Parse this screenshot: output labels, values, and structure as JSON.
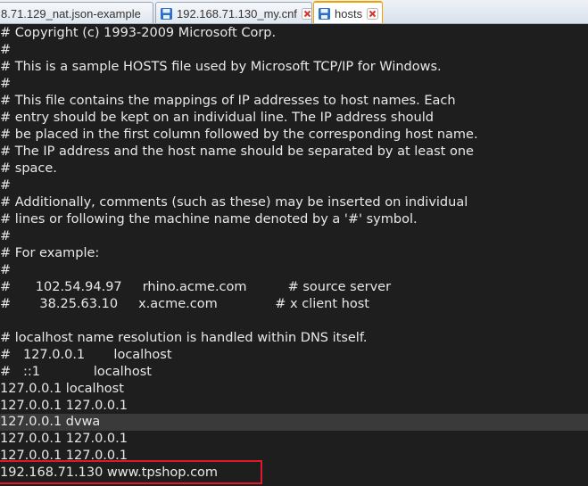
{
  "tabs": [
    {
      "label": "8.71.129_nat.json-example",
      "icon": "saved-file-icon",
      "active": false
    },
    {
      "label": "192.168.71.130_my.cnf",
      "icon": "saved-file-icon",
      "active": false
    },
    {
      "label": "hosts",
      "icon": "saved-file-icon",
      "active": true
    }
  ],
  "colors": {
    "editor_bg": "#1e1e1e",
    "text": "#e8e8e8",
    "highlight_row": "#3a3a3a",
    "active_tab_accent": "#f0a000",
    "annotation_box": "#e0182a",
    "close_icon": "#d9342b"
  },
  "editor": {
    "lines": [
      "# Copyright (c) 1993-2009 Microsoft Corp.",
      "#",
      "# This is a sample HOSTS file used by Microsoft TCP/IP for Windows.",
      "#",
      "# This file contains the mappings of IP addresses to host names. Each",
      "# entry should be kept on an individual line. The IP address should",
      "# be placed in the first column followed by the corresponding host name.",
      "# The IP address and the host name should be separated by at least one",
      "# space.",
      "#",
      "# Additionally, comments (such as these) may be inserted on individual",
      "# lines or following the machine name denoted by a '#' symbol.",
      "#",
      "# For example:",
      "#",
      "#      102.54.94.97     rhino.acme.com          # source server",
      "#       38.25.63.10     x.acme.com              # x client host",
      "",
      "# localhost name resolution is handled within DNS itself.",
      "#   127.0.0.1       localhost",
      "#   ::1             localhost",
      "127.0.0.1 localhost",
      "127.0.0.1 127.0.0.1",
      "127.0.0.1 dvwa",
      "127.0.0.1 127.0.0.1",
      "127.0.0.1 127.0.0.1",
      "192.168.71.130 www.tpshop.com"
    ]
  }
}
